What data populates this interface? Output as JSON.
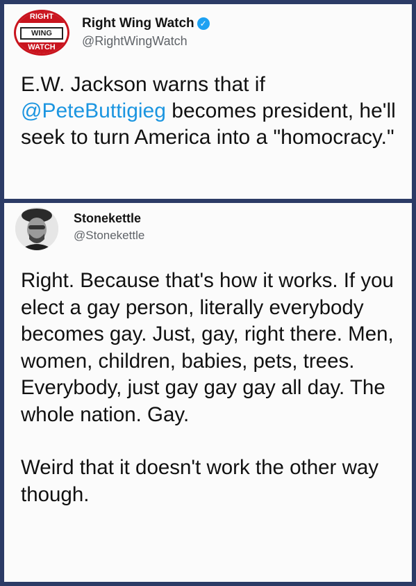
{
  "tweet1": {
    "logo": {
      "top": "RIGHT",
      "mid": "WING",
      "bottom": "WATCH"
    },
    "name": "Right Wing Watch",
    "handle": "@RightWingWatch",
    "verified_icon": "verified-badge-icon",
    "text_before": "E.W. Jackson warns that if ",
    "mention": "@PeteButtigieg",
    "text_after": " becomes president, he'll seek to turn America into a \"homocracy.\""
  },
  "tweet2": {
    "name": "Stonekettle",
    "handle": "@Stonekettle",
    "avatar_icon": "profile-photo",
    "paragraph1": "Right. Because that's how it works. If you elect a gay person, literally everybody becomes gay. Just, gay, right there. Men, women, children, babies, pets, trees. Everybody, just gay gay gay all day. The whole nation. Gay.",
    "paragraph2": "Weird that it doesn't work the other way though."
  },
  "colors": {
    "frame": "#2c3b66",
    "mention": "#1b95e0",
    "logo_red": "#c9141e",
    "verified": "#1da1f2"
  }
}
